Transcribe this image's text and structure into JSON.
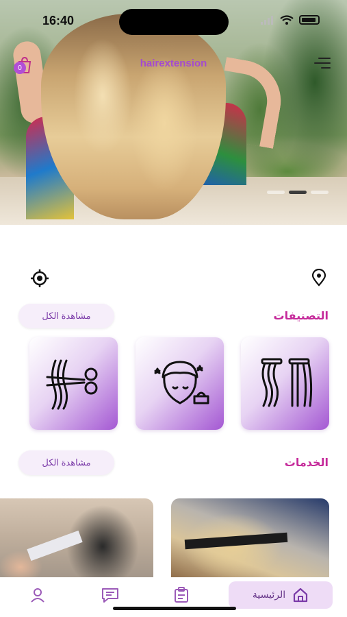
{
  "status_bar": {
    "time": "16:40"
  },
  "header": {
    "brand": "hairextension",
    "cart_count": "0",
    "cart_icon": "shopping-bag-icon",
    "menu_icon": "menu-icon"
  },
  "carousel": {
    "slides": 3,
    "active_index": 1
  },
  "location": {
    "left_icon": "locate-me-icon",
    "right_icon": "map-pin-icon"
  },
  "categories": {
    "title": "التصنيفات",
    "view_all": "مشاهدة الكل",
    "items": [
      {
        "icon": "hair-extension-strands-icon"
      },
      {
        "icon": "hair-treatment-towel-icon"
      },
      {
        "icon": "hair-cut-scissors-icon"
      }
    ]
  },
  "services": {
    "title": "الخدمات",
    "view_all": "مشاهدة الكل"
  },
  "bottom_nav": {
    "home_label": "الرئيسية",
    "items": [
      "home-icon",
      "orders-icon",
      "chat-icon",
      "profile-icon"
    ]
  },
  "colors": {
    "accent": "#c52a9a",
    "brand": "#a44ad0",
    "card_gradient_end": "#a458d3",
    "nav_active_bg": "#eedcf6"
  }
}
